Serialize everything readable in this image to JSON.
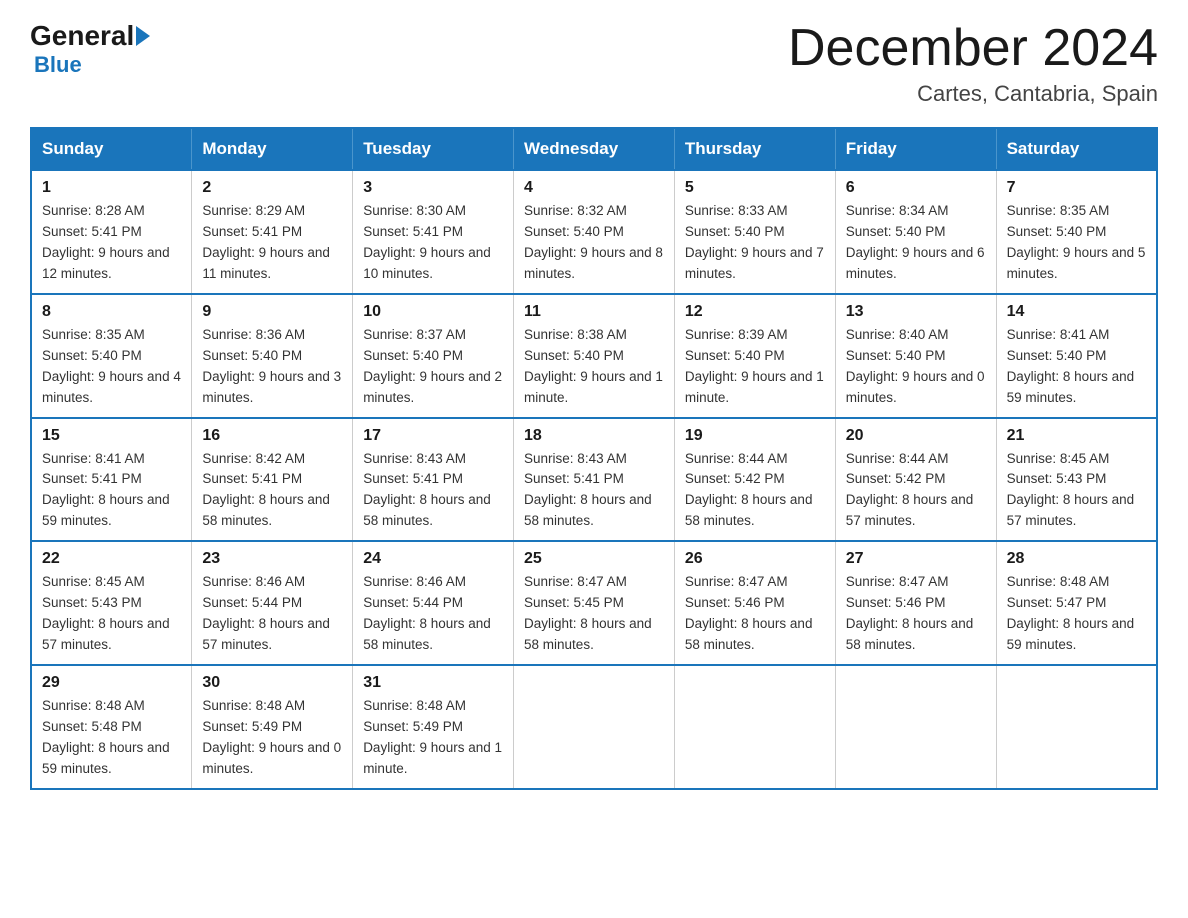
{
  "header": {
    "logo_general": "General",
    "logo_blue": "Blue",
    "month_title": "December 2024",
    "location": "Cartes, Cantabria, Spain"
  },
  "days_of_week": [
    "Sunday",
    "Monday",
    "Tuesday",
    "Wednesday",
    "Thursday",
    "Friday",
    "Saturday"
  ],
  "weeks": [
    [
      {
        "day": "1",
        "sunrise": "8:28 AM",
        "sunset": "5:41 PM",
        "daylight": "9 hours and 12 minutes."
      },
      {
        "day": "2",
        "sunrise": "8:29 AM",
        "sunset": "5:41 PM",
        "daylight": "9 hours and 11 minutes."
      },
      {
        "day": "3",
        "sunrise": "8:30 AM",
        "sunset": "5:41 PM",
        "daylight": "9 hours and 10 minutes."
      },
      {
        "day": "4",
        "sunrise": "8:32 AM",
        "sunset": "5:40 PM",
        "daylight": "9 hours and 8 minutes."
      },
      {
        "day": "5",
        "sunrise": "8:33 AM",
        "sunset": "5:40 PM",
        "daylight": "9 hours and 7 minutes."
      },
      {
        "day": "6",
        "sunrise": "8:34 AM",
        "sunset": "5:40 PM",
        "daylight": "9 hours and 6 minutes."
      },
      {
        "day": "7",
        "sunrise": "8:35 AM",
        "sunset": "5:40 PM",
        "daylight": "9 hours and 5 minutes."
      }
    ],
    [
      {
        "day": "8",
        "sunrise": "8:35 AM",
        "sunset": "5:40 PM",
        "daylight": "9 hours and 4 minutes."
      },
      {
        "day": "9",
        "sunrise": "8:36 AM",
        "sunset": "5:40 PM",
        "daylight": "9 hours and 3 minutes."
      },
      {
        "day": "10",
        "sunrise": "8:37 AM",
        "sunset": "5:40 PM",
        "daylight": "9 hours and 2 minutes."
      },
      {
        "day": "11",
        "sunrise": "8:38 AM",
        "sunset": "5:40 PM",
        "daylight": "9 hours and 1 minute."
      },
      {
        "day": "12",
        "sunrise": "8:39 AM",
        "sunset": "5:40 PM",
        "daylight": "9 hours and 1 minute."
      },
      {
        "day": "13",
        "sunrise": "8:40 AM",
        "sunset": "5:40 PM",
        "daylight": "9 hours and 0 minutes."
      },
      {
        "day": "14",
        "sunrise": "8:41 AM",
        "sunset": "5:40 PM",
        "daylight": "8 hours and 59 minutes."
      }
    ],
    [
      {
        "day": "15",
        "sunrise": "8:41 AM",
        "sunset": "5:41 PM",
        "daylight": "8 hours and 59 minutes."
      },
      {
        "day": "16",
        "sunrise": "8:42 AM",
        "sunset": "5:41 PM",
        "daylight": "8 hours and 58 minutes."
      },
      {
        "day": "17",
        "sunrise": "8:43 AM",
        "sunset": "5:41 PM",
        "daylight": "8 hours and 58 minutes."
      },
      {
        "day": "18",
        "sunrise": "8:43 AM",
        "sunset": "5:41 PM",
        "daylight": "8 hours and 58 minutes."
      },
      {
        "day": "19",
        "sunrise": "8:44 AM",
        "sunset": "5:42 PM",
        "daylight": "8 hours and 58 minutes."
      },
      {
        "day": "20",
        "sunrise": "8:44 AM",
        "sunset": "5:42 PM",
        "daylight": "8 hours and 57 minutes."
      },
      {
        "day": "21",
        "sunrise": "8:45 AM",
        "sunset": "5:43 PM",
        "daylight": "8 hours and 57 minutes."
      }
    ],
    [
      {
        "day": "22",
        "sunrise": "8:45 AM",
        "sunset": "5:43 PM",
        "daylight": "8 hours and 57 minutes."
      },
      {
        "day": "23",
        "sunrise": "8:46 AM",
        "sunset": "5:44 PM",
        "daylight": "8 hours and 57 minutes."
      },
      {
        "day": "24",
        "sunrise": "8:46 AM",
        "sunset": "5:44 PM",
        "daylight": "8 hours and 58 minutes."
      },
      {
        "day": "25",
        "sunrise": "8:47 AM",
        "sunset": "5:45 PM",
        "daylight": "8 hours and 58 minutes."
      },
      {
        "day": "26",
        "sunrise": "8:47 AM",
        "sunset": "5:46 PM",
        "daylight": "8 hours and 58 minutes."
      },
      {
        "day": "27",
        "sunrise": "8:47 AM",
        "sunset": "5:46 PM",
        "daylight": "8 hours and 58 minutes."
      },
      {
        "day": "28",
        "sunrise": "8:48 AM",
        "sunset": "5:47 PM",
        "daylight": "8 hours and 59 minutes."
      }
    ],
    [
      {
        "day": "29",
        "sunrise": "8:48 AM",
        "sunset": "5:48 PM",
        "daylight": "8 hours and 59 minutes."
      },
      {
        "day": "30",
        "sunrise": "8:48 AM",
        "sunset": "5:49 PM",
        "daylight": "9 hours and 0 minutes."
      },
      {
        "day": "31",
        "sunrise": "8:48 AM",
        "sunset": "5:49 PM",
        "daylight": "9 hours and 1 minute."
      },
      null,
      null,
      null,
      null
    ]
  ]
}
